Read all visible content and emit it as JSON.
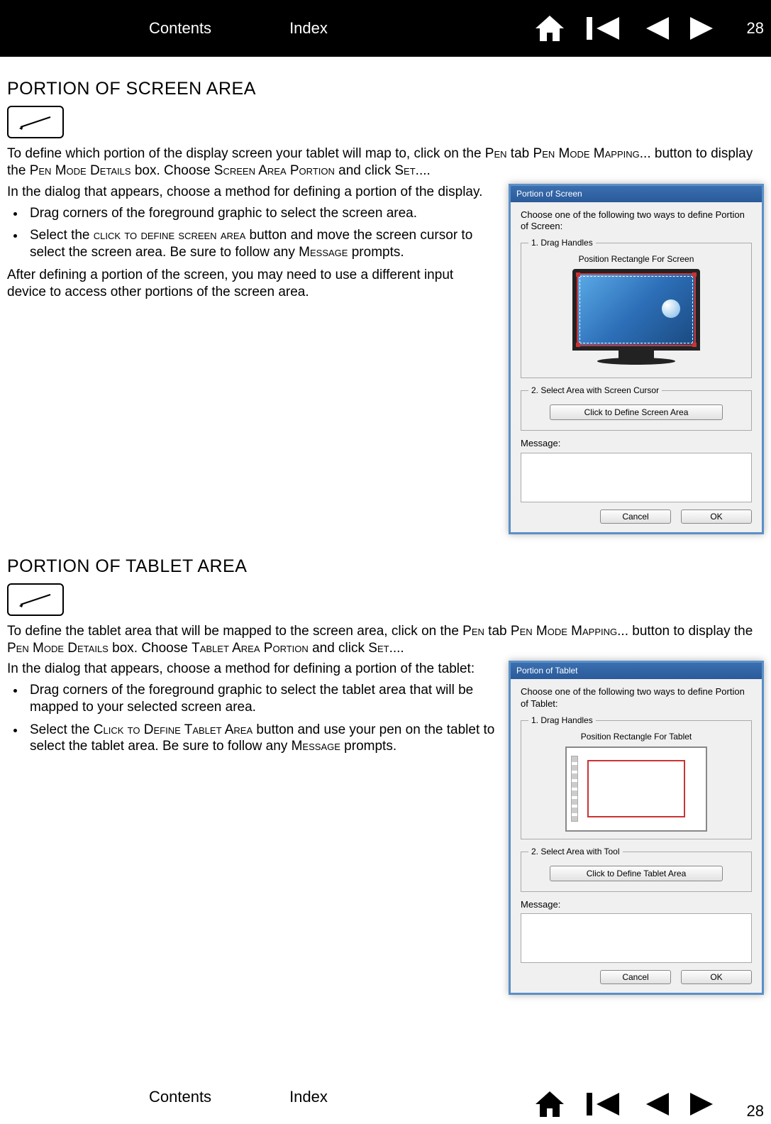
{
  "nav": {
    "contents": "Contents",
    "index": "Index",
    "page": "28"
  },
  "section1": {
    "heading": "PORTION OF SCREEN AREA",
    "intro_a": "To define which portion of the display screen your tablet will map to, click on the ",
    "intro_b": " tab ",
    "intro_c": "... button to display the ",
    "intro_d": " box. Choose ",
    "intro_e": " and click ",
    "intro_f": "....",
    "sc_pen": "Pen",
    "sc_penmodemapping": "Pen Mode Mapping",
    "sc_penmodedetails": "Pen Mode Details",
    "sc_screenareaportion": "Screen Area Portion",
    "sc_set": "Set",
    "para1": "In the dialog that appears, choose a method for defining a portion of the display.",
    "bullet1": "Drag corners of the foreground graphic to select the screen area.",
    "bullet2_a": "Select the ",
    "bullet2_b": " button and move the screen cursor to select the screen area. Be sure to follow any ",
    "bullet2_c": " prompts.",
    "sc_clickdefinescreen": "click to define screen area",
    "sc_message": "Message",
    "after": "After defining a portion of the screen, you may need to use a different input device to access other portions of the screen area."
  },
  "dialog1": {
    "title": "Portion of Screen",
    "intro": "Choose one of the following two ways to define Portion of Screen:",
    "legend1": "1. Drag Handles",
    "caption1": "Position Rectangle For Screen",
    "legend2": "2. Select Area with Screen Cursor",
    "button": "Click to Define Screen Area",
    "message_label": "Message:",
    "cancel": "Cancel",
    "ok": "OK"
  },
  "section2": {
    "heading": "PORTION OF TABLET AREA",
    "intro_a": "To define the tablet area that will be mapped to the screen area, click on the ",
    "intro_b": " tab ",
    "intro_c": "... button to display the ",
    "intro_d": " box. Choose ",
    "intro_e": " and click ",
    "intro_f": "....",
    "sc_tabletareaportion": "Tablet Area Portion",
    "para1": "In the dialog that appears, choose a method for defining a portion of the tablet:",
    "bullet1": "Drag corners of the foreground graphic to select the tablet area that will be mapped to your selected screen area.",
    "bullet2_a": "Select the ",
    "bullet2_b": " button and use your pen on the tablet to select the tablet area. Be sure to follow any ",
    "bullet2_c": " prompts.",
    "sc_clickdefinetablet": "Click to Define Tablet Area"
  },
  "dialog2": {
    "title": "Portion of Tablet",
    "intro": "Choose one of the following two ways to define Portion of Tablet:",
    "legend1": "1. Drag Handles",
    "caption1": "Position Rectangle For Tablet",
    "legend2": "2. Select Area with Tool",
    "button": "Click to Define Tablet Area",
    "message_label": "Message:",
    "cancel": "Cancel",
    "ok": "OK"
  }
}
